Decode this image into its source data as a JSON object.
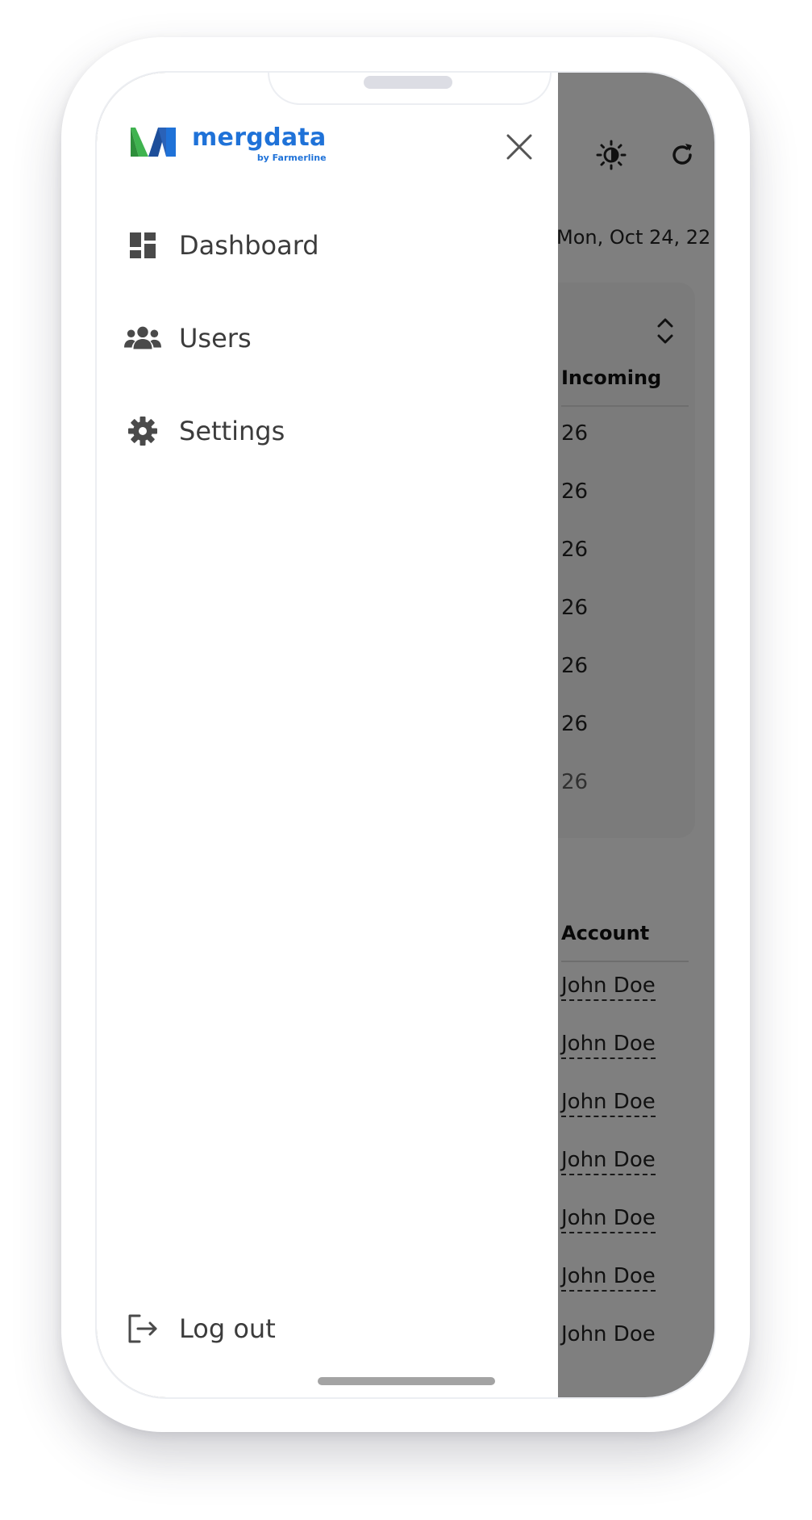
{
  "background_app": {
    "date": "Mon, Oct 24, 22",
    "table1": {
      "header": "Incoming",
      "rows": [
        "26",
        "26",
        "26",
        "26",
        "26",
        "26",
        "26"
      ]
    },
    "table2": {
      "header": "Account",
      "rows": [
        "John Doe",
        "John Doe",
        "John Doe",
        "John Doe",
        "John Doe",
        "John Doe",
        "John Doe"
      ]
    },
    "icons": [
      "notification-icon",
      "brightness-icon",
      "refresh-icon"
    ]
  },
  "drawer": {
    "logo": {
      "name": "mergdata",
      "tagline": "by Farmerline",
      "colors": {
        "green": "#3fb34f",
        "blue": "#1f72d8",
        "navy": "#1d4e9a"
      }
    },
    "close_icon": "close-icon",
    "nav": [
      {
        "label": "Dashboard",
        "icon": "dashboard-icon"
      },
      {
        "label": "Users",
        "icon": "users-icon"
      },
      {
        "label": "Settings",
        "icon": "gear-icon"
      }
    ],
    "logout": {
      "label": "Log out",
      "icon": "logout-icon"
    }
  },
  "colors": {
    "overlay": "rgba(0,0,0,0.5)",
    "nav_text": "#3c3c3c",
    "nav_icon": "#4a4a4a",
    "brand_blue": "#1f72d8"
  }
}
